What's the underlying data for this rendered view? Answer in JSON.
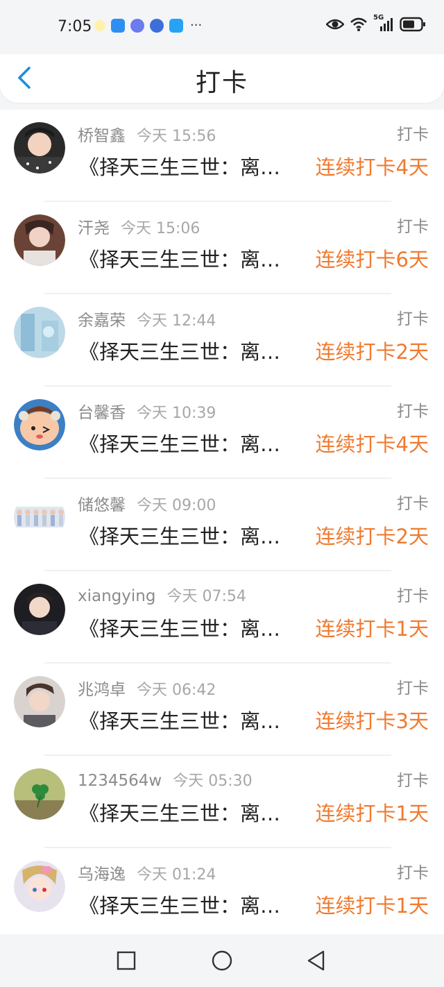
{
  "status_bar": {
    "time": "7:05",
    "more_notifications": "···",
    "network": "5G"
  },
  "header": {
    "title": "打卡"
  },
  "colors": {
    "accent": "#f07a2f",
    "back_arrow": "#1a8fe0"
  },
  "items": [
    {
      "name": "桥智鑫",
      "time": "今天 15:56",
      "type": "打卡",
      "book": "《择天三生三世：离人泪》",
      "streak": "连续打卡4天",
      "avatar_icon": "avatar-child-icon"
    },
    {
      "name": "汗尧",
      "time": "今天 15:06",
      "type": "打卡",
      "book": "《择天三生三世：离人泪》",
      "streak": "连续打卡6天",
      "avatar_icon": "avatar-girl-icon"
    },
    {
      "name": "余嘉荣",
      "time": "今天 12:44",
      "type": "打卡",
      "book": "《择天三生三世：离人泪》",
      "streak": "连续打卡2天",
      "avatar_icon": "avatar-icy-icon"
    },
    {
      "name": "台馨香",
      "time": "今天 10:39",
      "type": "打卡",
      "book": "《择天三生三世：离人泪》",
      "streak": "连续打卡4天",
      "avatar_icon": "avatar-cartoon-icon"
    },
    {
      "name": "储悠馨",
      "time": "今天 09:00",
      "type": "打卡",
      "book": "《择天三生三世：离人泪》",
      "streak": "连续打卡2天",
      "avatar_icon": "avatar-group-icon"
    },
    {
      "name": "xiangying",
      "time": "今天 07:54",
      "type": "打卡",
      "book": "《择天三生三世：离人泪》",
      "streak": "连续打卡1天",
      "avatar_icon": "avatar-man-icon"
    },
    {
      "name": "兆鸿卓",
      "time": "今天 06:42",
      "type": "打卡",
      "book": "《择天三生三世：离人泪》",
      "streak": "连续打卡3天",
      "avatar_icon": "avatar-boy-icon"
    },
    {
      "name": "1234564w",
      "time": "今天 05:30",
      "type": "打卡",
      "book": "《择天三生三世：离人泪》",
      "streak": "连续打卡1天",
      "avatar_icon": "avatar-clover-icon"
    },
    {
      "name": "乌海逸",
      "time": "今天 01:24",
      "type": "打卡",
      "book": "《择天三生三世：离人泪》",
      "streak": "连续打卡1天",
      "avatar_icon": "avatar-anime-icon"
    }
  ]
}
